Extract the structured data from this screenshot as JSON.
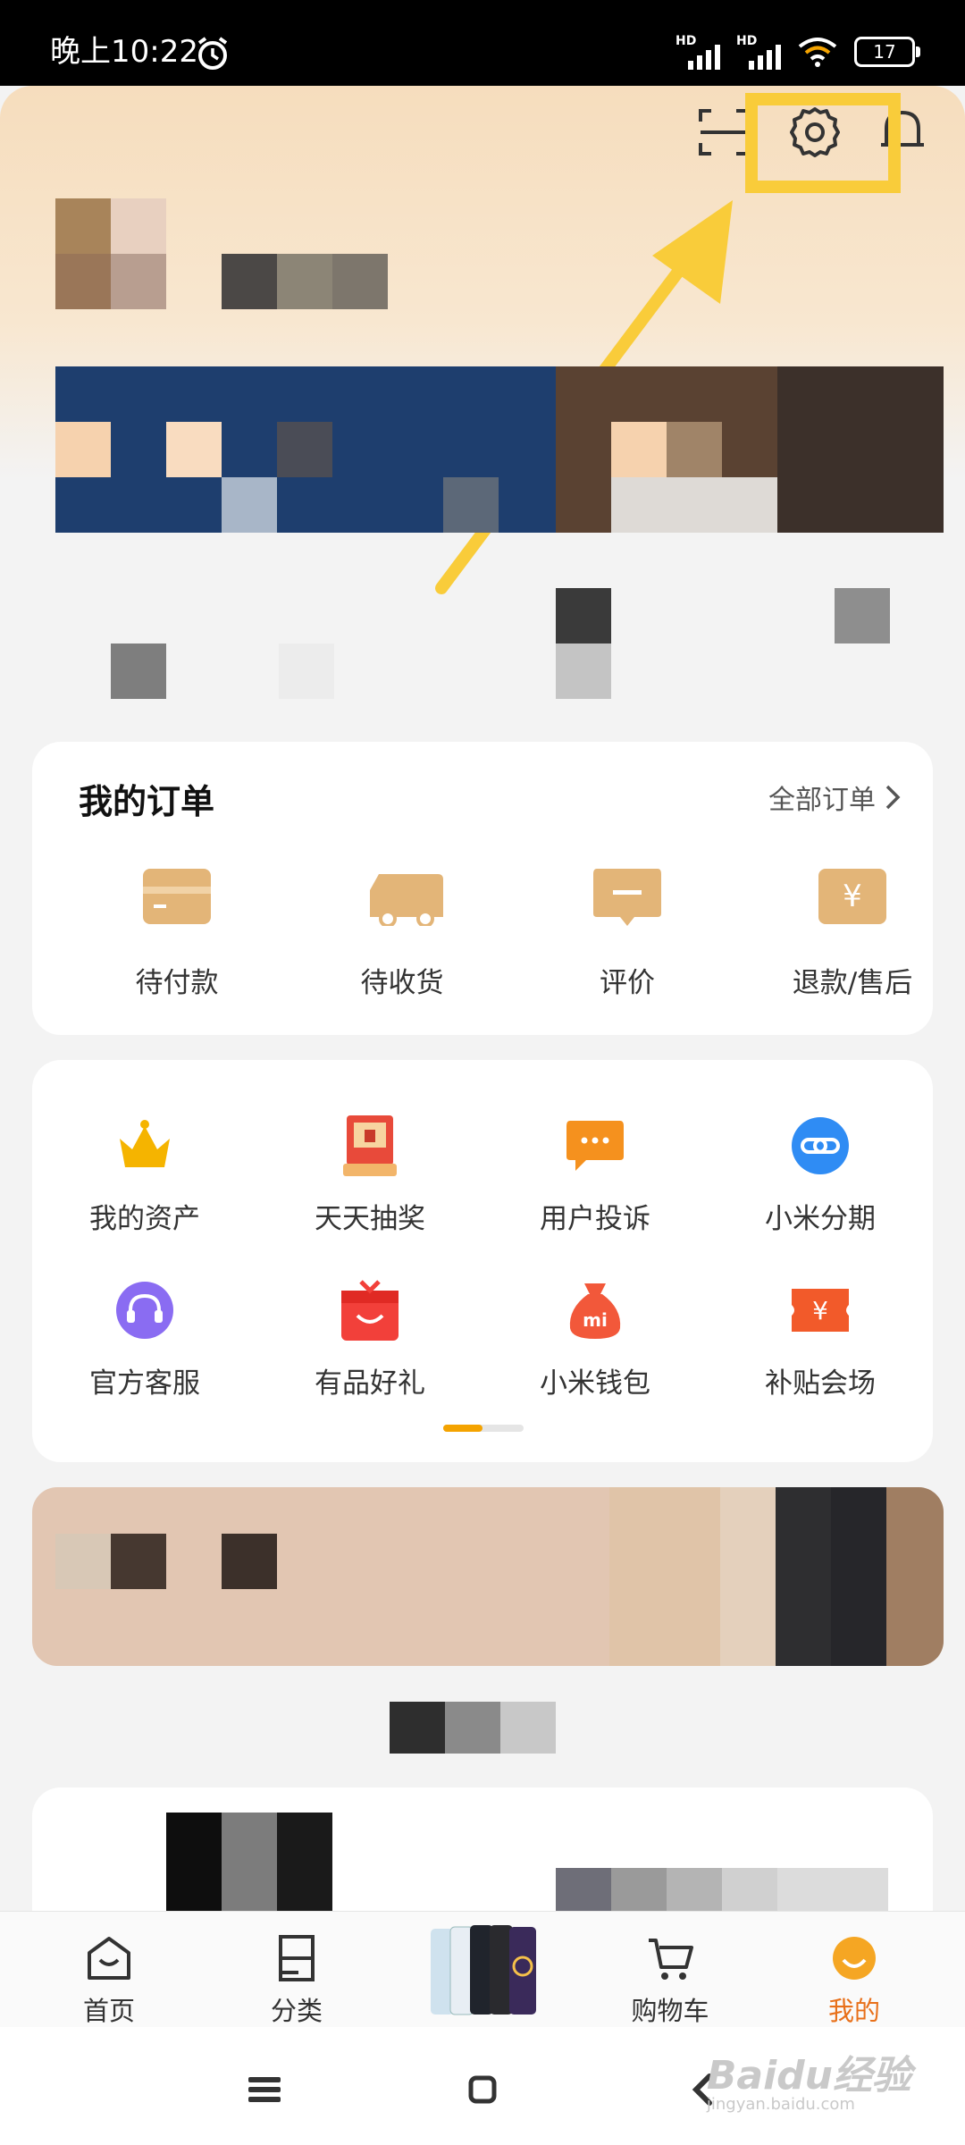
{
  "status_bar": {
    "time": "晚上10:22",
    "battery": "17",
    "signal_label": "HD"
  },
  "order_card": {
    "title": "我的订单",
    "all_orders": "全部订单",
    "items": [
      {
        "label": "待付款",
        "icon": "wallet-card-icon"
      },
      {
        "label": "待收货",
        "icon": "delivery-truck-icon"
      },
      {
        "label": "评价",
        "icon": "comment-icon"
      },
      {
        "label": "退款/售后",
        "icon": "refund-yen-icon"
      }
    ]
  },
  "services": {
    "items": [
      {
        "label": "我的资产",
        "icon": "crown-icon"
      },
      {
        "label": "天天抽奖",
        "icon": "lottery-machine-icon"
      },
      {
        "label": "用户投诉",
        "icon": "chat-bubble-icon"
      },
      {
        "label": "小米分期",
        "icon": "link-icon"
      },
      {
        "label": "官方客服",
        "icon": "headset-icon"
      },
      {
        "label": "有品好礼",
        "icon": "gift-box-icon"
      },
      {
        "label": "小米钱包",
        "icon": "money-bag-icon"
      },
      {
        "label": "补贴会场",
        "icon": "coupon-yen-icon"
      }
    ]
  },
  "bottom_nav": {
    "items": [
      {
        "label": "首页",
        "icon": "home-icon"
      },
      {
        "label": "分类",
        "icon": "category-icon"
      },
      {
        "label": "购物车",
        "icon": "cart-icon"
      },
      {
        "label": "我的",
        "icon": "profile-icon"
      }
    ]
  },
  "watermark": {
    "text": "Baidu经验",
    "sub": "jingyan.baidu.com"
  },
  "colors": {
    "accent": "#f9cc3a",
    "active_tab": "#e8701a",
    "icon_beige": "#e3b578"
  }
}
